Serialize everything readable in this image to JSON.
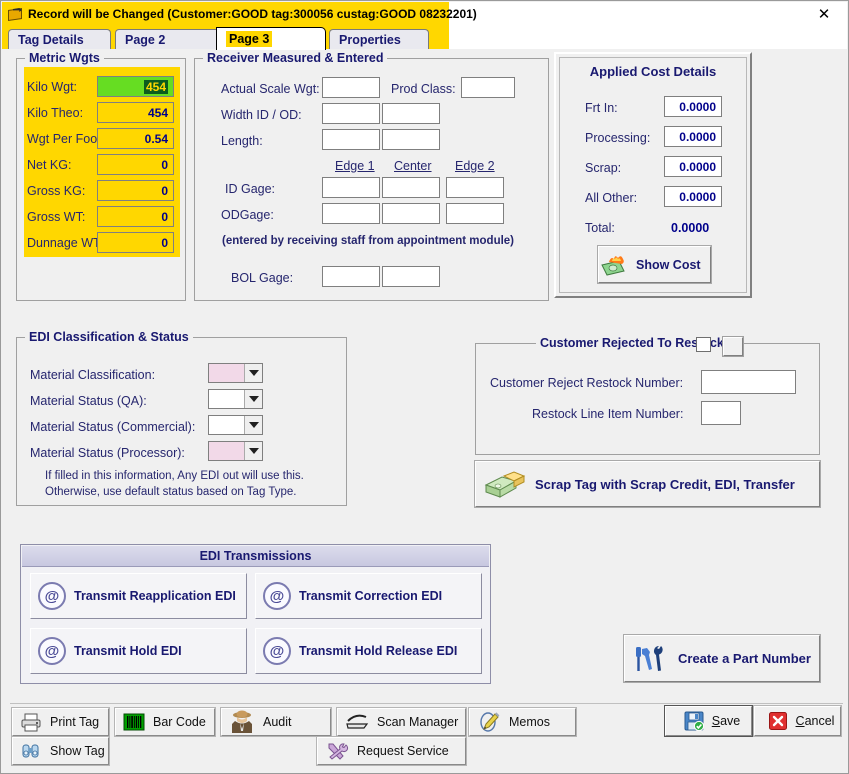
{
  "window": {
    "title": "Record will be Changed  (Customer:GOOD   tag:300056 custag:GOOD 08232201)",
    "icon": "record-tag-icon",
    "close_label": "✕"
  },
  "tabs": [
    {
      "label": "Tag Details",
      "active": false
    },
    {
      "label": "Page 2",
      "active": false
    },
    {
      "label": "Page 3",
      "active": true
    },
    {
      "label": "Properties",
      "active": false
    }
  ],
  "metric_wgts": {
    "title": "Metric Wgts",
    "rows": [
      {
        "label": "Kilo Wgt:",
        "value": "454",
        "style": "green-selected"
      },
      {
        "label": "Kilo Theo:",
        "value": "454",
        "style": "yellow"
      },
      {
        "label": "Wgt Per Foot:",
        "value": "0.54",
        "style": "yellow"
      },
      {
        "label": "Net KG:",
        "value": "0",
        "style": "yellow"
      },
      {
        "label": "Gross KG:",
        "value": "0",
        "style": "yellow"
      },
      {
        "label": "Gross WT:",
        "value": "0",
        "style": "yellow"
      },
      {
        "label": "Dunnage WT:",
        "value": "0",
        "style": "yellow"
      }
    ]
  },
  "receiver": {
    "title": "Receiver Measured & Entered",
    "actual_scale_wgt_label": "Actual Scale Wgt:",
    "actual_scale_wgt_value": "",
    "prod_class_label": "Prod Class:",
    "prod_class_value": "",
    "width_id_od_label": "Width ID / OD:",
    "width_id_value": "",
    "width_od_value": "",
    "length_label": "Length:",
    "length_value_1": "",
    "length_value_2": "",
    "col_edge1": "Edge 1",
    "col_center": "Center",
    "col_edge2": "Edge 2",
    "id_gage_label": "ID Gage:",
    "id_gage_edge1": "",
    "id_gage_center": "",
    "id_gage_edge2": "",
    "od_gage_label": "ODGage:",
    "od_gage_edge1": "",
    "od_gage_center": "",
    "od_gage_edge2": "",
    "note": "(entered by receiving staff from appointment module)",
    "bol_gage_label": "BOL Gage:",
    "bol_gage_value_1": "",
    "bol_gage_value_2": ""
  },
  "applied_cost": {
    "title": "Applied Cost Details",
    "rows": [
      {
        "label": "Frt In:",
        "value": "0.0000"
      },
      {
        "label": "Processing:",
        "value": "0.0000"
      },
      {
        "label": "Scrap:",
        "value": "0.0000"
      },
      {
        "label": "All Other:",
        "value": "0.0000"
      }
    ],
    "total_label": "Total:",
    "total_value": "0.0000",
    "show_cost_button": "Show Cost",
    "show_cost_icon": "burning-money-icon"
  },
  "edi_classification": {
    "title": "EDI Classification & Status",
    "rows": [
      {
        "label": "Material Classification:",
        "value": "",
        "fill": "pink"
      },
      {
        "label": "Material Status (QA):",
        "value": "",
        "fill": "white"
      },
      {
        "label": "Material Status (Commercial):",
        "value": "",
        "fill": "white"
      },
      {
        "label": "Material Status (Processor):",
        "value": "",
        "fill": "pink"
      }
    ],
    "note_line_1": "If filled in this information, Any EDI out will use this.",
    "note_line_2": "Otherwise, use default status based on Tag Type."
  },
  "customer_restock": {
    "title": "Customer Rejected To Restock",
    "checkbox_checked": false,
    "reject_number_label": "Customer Reject Restock Number:",
    "reject_number_value": "",
    "line_item_label": "Restock Line Item Number:",
    "line_item_value": "",
    "scrap_tag_button": "Scrap Tag with Scrap Credit, EDI, Transfer",
    "scrap_tag_icon": "money-stack-icon"
  },
  "edi_transmissions": {
    "title": "EDI Transmissions",
    "buttons": [
      {
        "label": "Transmit Reapplication EDI",
        "icon": "at-sign-icon"
      },
      {
        "label": "Transmit Correction EDI",
        "icon": "at-sign-icon"
      },
      {
        "label": "Transmit Hold EDI",
        "icon": "at-sign-icon"
      },
      {
        "label": "Transmit Hold Release EDI",
        "icon": "at-sign-icon"
      }
    ]
  },
  "create_part": {
    "label": "Create a Part Number",
    "icon": "tools-icon"
  },
  "toolbar": {
    "print_tag": "Print Tag",
    "print_tag_icon": "printer-icon",
    "show_tag": "Show Tag",
    "show_tag_icon": "binoculars-icon",
    "bar_code": "Bar Code",
    "bar_code_icon": "barcode-icon",
    "audit": "Audit",
    "audit_icon": "detective-icon",
    "scan_manager": "Scan Manager",
    "scan_manager_icon": "scanner-icon",
    "request_service": "Request Service",
    "request_service_icon": "tools-wrench-icon",
    "memos": "Memos",
    "memos_icon": "pencil-icon",
    "save": "Save",
    "save_accel": "S",
    "save_icon": "floppy-disk-icon",
    "cancel": "Cancel",
    "cancel_accel": "C",
    "cancel_icon": "red-x-icon"
  },
  "colors": {
    "title_bar": "#ffd700",
    "metric_fill": "#ffd700",
    "focus_field": "#66dd22",
    "selection": "#0b5c1e",
    "accent_text": "#191970",
    "pink_combo": "#f2d9e8"
  }
}
